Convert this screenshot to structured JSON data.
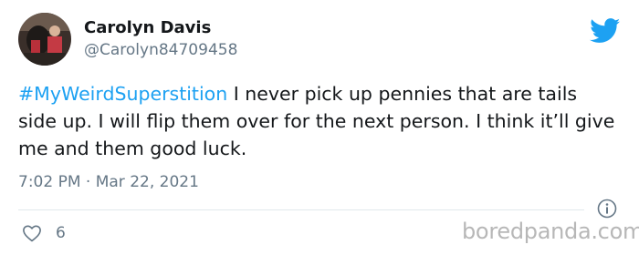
{
  "author": {
    "name": "Carolyn Davis",
    "handle": "@Carolyn84709458"
  },
  "tweet": {
    "hashtag": "#MyWeirdSuperstition",
    "text": " I never pick up pennies that are tails side up. I will flip them over for the next person. I think it’ll give me and them good luck.",
    "timestamp": "7:02 PM · Mar 22, 2021",
    "like_count": "6"
  },
  "watermark": "boredpanda.com",
  "icons": {
    "brand": "twitter-bird-icon",
    "like": "heart-icon",
    "info": "info-icon"
  },
  "colors": {
    "link": "#1da1f2",
    "text": "#14171a",
    "muted": "#657786"
  }
}
